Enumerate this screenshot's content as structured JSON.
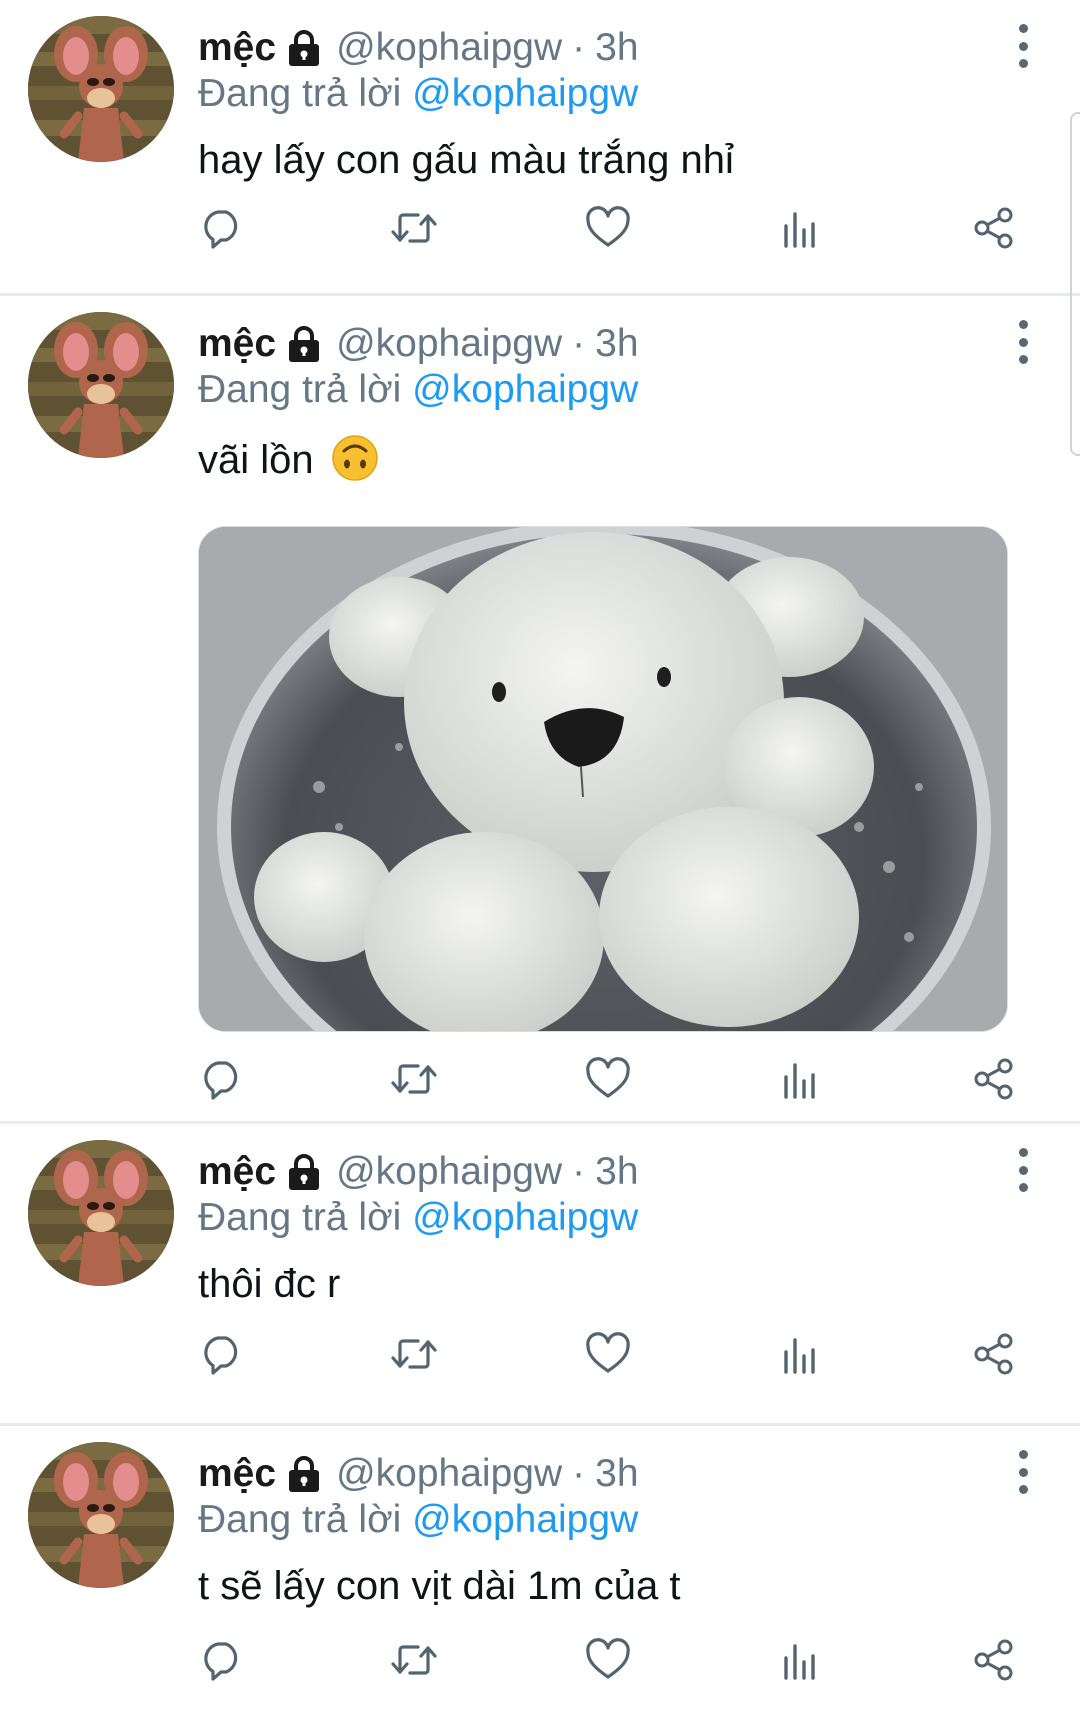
{
  "colors": {
    "accent": "#1d9bf0",
    "secondary_text": "#657786",
    "divider": "#e8ecef"
  },
  "tweets": [
    {
      "display_name": "mệc",
      "handle": "@kophaipgw",
      "separator": "·",
      "time": "3h",
      "replying_prefix": "Đang trả lời",
      "replying_to": "@kophaipgw",
      "text": "hay lấy con gấu màu trắng nhỉ",
      "has_emoji": false,
      "has_media": false
    },
    {
      "display_name": "mệc",
      "handle": "@kophaipgw",
      "separator": "·",
      "time": "3h",
      "replying_prefix": "Đang trả lời",
      "replying_to": "@kophaipgw",
      "text": "vãi lồn",
      "has_emoji": true,
      "emoji": "upside-down-face",
      "has_media": true,
      "media": "white-teddy-bear-in-washing-machine"
    },
    {
      "display_name": "mệc",
      "handle": "@kophaipgw",
      "separator": "·",
      "time": "3h",
      "replying_prefix": "Đang trả lời",
      "replying_to": "@kophaipgw",
      "text": "thôi đc r",
      "has_emoji": false,
      "has_media": false
    },
    {
      "display_name": "mệc",
      "handle": "@kophaipgw",
      "separator": "·",
      "time": "3h",
      "replying_prefix": "Đang trả lời",
      "replying_to": "@kophaipgw",
      "text": "t sẽ lấy con vịt dài 1m của t",
      "has_emoji": false,
      "has_media": false
    }
  ],
  "icons": {
    "lock": "lock-icon",
    "more": "more-vertical-icon",
    "actions": [
      "reply-icon",
      "retweet-icon",
      "like-icon",
      "analytics-icon",
      "share-icon"
    ]
  }
}
